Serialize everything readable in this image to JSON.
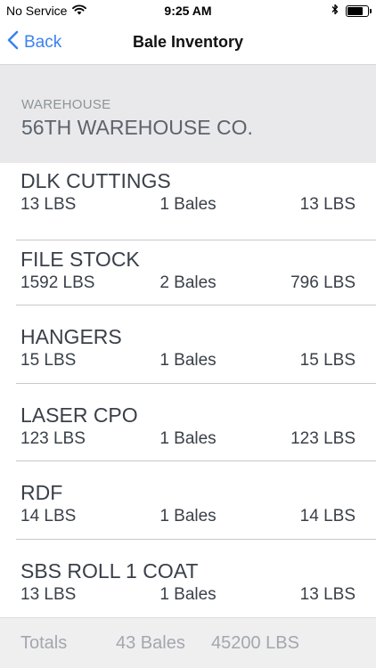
{
  "status_bar": {
    "carrier": "No Service",
    "time": "9:25 AM",
    "battery_level": 0.85
  },
  "nav": {
    "back_label": "Back",
    "title": "Bale Inventory"
  },
  "warehouse": {
    "caption": "WAREHOUSE",
    "name": "56TH WAREHOUSE CO."
  },
  "items": [
    {
      "name": "DLK CUTTINGS",
      "total_weight": "13 LBS",
      "bales": "1 Bales",
      "avg_weight": "13 LBS"
    },
    {
      "name": "FILE STOCK",
      "total_weight": "1592 LBS",
      "bales": "2 Bales",
      "avg_weight": "796 LBS"
    },
    {
      "name": "HANGERS",
      "total_weight": "15 LBS",
      "bales": "1 Bales",
      "avg_weight": "15 LBS"
    },
    {
      "name": "LASER CPO",
      "total_weight": "123 LBS",
      "bales": "1 Bales",
      "avg_weight": "123 LBS"
    },
    {
      "name": "RDF",
      "total_weight": "14 LBS",
      "bales": "1 Bales",
      "avg_weight": "14 LBS"
    },
    {
      "name": "SBS ROLL 1 COAT",
      "total_weight": "13 LBS",
      "bales": "1 Bales",
      "avg_weight": "13 LBS"
    }
  ],
  "totals": {
    "label": "Totals",
    "bales": "43 Bales",
    "weight": "45200 LBS"
  },
  "colors": {
    "accent": "#3b82f0",
    "header_bg": "#e9e9eb",
    "footer_bg": "#efeff0"
  }
}
